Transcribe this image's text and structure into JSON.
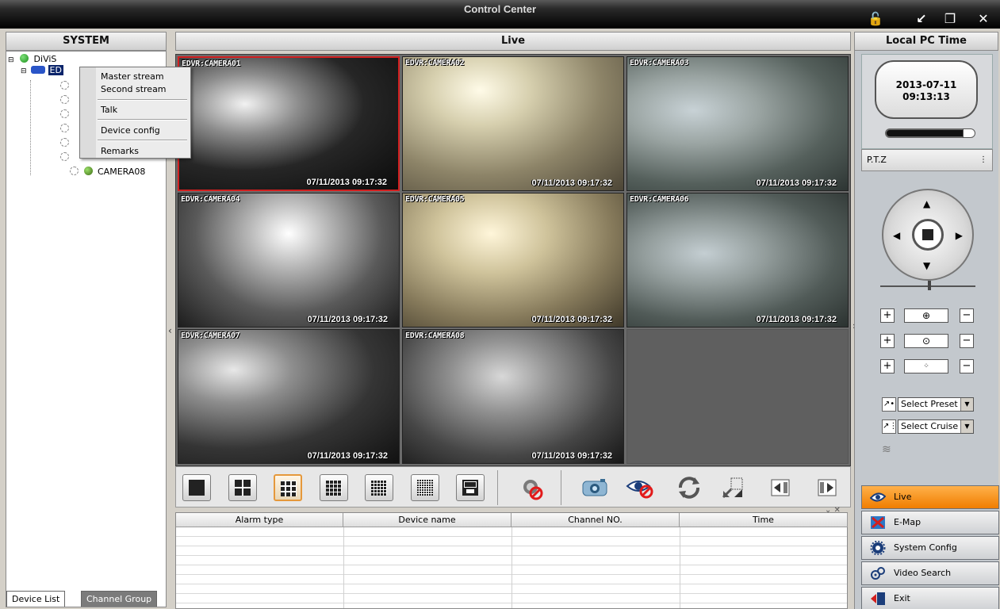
{
  "window": {
    "title": "Control Center"
  },
  "headers": {
    "system": "SYSTEM",
    "live": "Live",
    "local_pc_time": "Local PC Time"
  },
  "tree": {
    "root": "DiViS",
    "device": "ED",
    "cameras": [
      "CAMERA08"
    ]
  },
  "context_menu": {
    "items": [
      "Master stream",
      "Second stream",
      "Talk",
      "Device config",
      "Remarks"
    ]
  },
  "tabs": {
    "device_list": "Device List",
    "channel_group": "Channel Group"
  },
  "cameras": [
    {
      "label": "EDVR:CAMERA01",
      "time": "07/11/2013 09:17:32",
      "selected": true
    },
    {
      "label": "EDVR:CAMERA02",
      "time": "07/11/2013 09:17:32"
    },
    {
      "label": "EDVR:CAMERA03",
      "time": "07/11/2013 09:17:32"
    },
    {
      "label": "EDVR:CAMERA04",
      "time": "07/11/2013 09:17:32"
    },
    {
      "label": "EDVR:CAMERA05",
      "time": "07/11/2013 09:17:32"
    },
    {
      "label": "EDVR:CAMERA06",
      "time": "07/11/2013 09:17:32"
    },
    {
      "label": "EDVR:CAMERA07",
      "time": "07/11/2013 09:17:32"
    },
    {
      "label": "EDVR:CAMERA08",
      "time": "07/11/2013 09:17:32"
    }
  ],
  "toolbar": {
    "layouts": [
      "1x1",
      "2x2",
      "3x3",
      "4x4",
      "5x5",
      "6x6",
      "custom"
    ],
    "selected_layout": "3x3"
  },
  "alarm_table": {
    "columns": [
      "Alarm type",
      "Device name",
      "Channel NO.",
      "Time"
    ]
  },
  "clock": {
    "date": "2013-07-11",
    "time": "09:13:13"
  },
  "ptz": {
    "label": "P.T.Z",
    "preset": "Select Preset",
    "cruise": "Select Cruise"
  },
  "nav": {
    "items": [
      "Live",
      "E-Map",
      "System Config",
      "Video Search",
      "Exit"
    ],
    "active": "Live"
  },
  "colors": {
    "accent": "#f28a17",
    "selected_border": "#d21f1f"
  }
}
